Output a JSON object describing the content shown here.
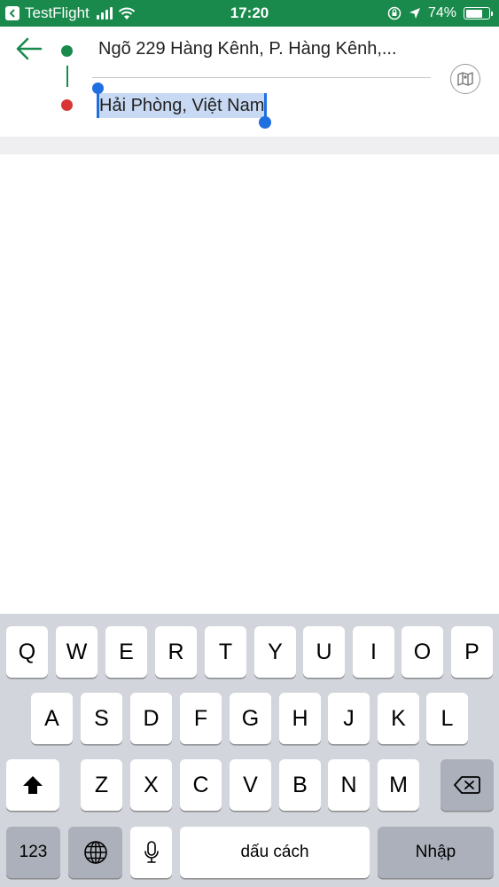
{
  "status_bar": {
    "back_app": "TestFlight",
    "time": "17:20",
    "battery": "74%",
    "battery_level": 0.74
  },
  "route": {
    "origin": "Ngõ 229 Hàng Kênh, P. Hàng Kênh,...",
    "destination": "Hải Phòng, Việt Nam",
    "origin_color": "#1a8a4c",
    "destination_color": "#d93535"
  },
  "icons": {
    "back": "arrow-left-icon",
    "map": "map-icon"
  },
  "keyboard": {
    "row1": [
      "Q",
      "W",
      "E",
      "R",
      "T",
      "Y",
      "U",
      "I",
      "O",
      "P"
    ],
    "row2": [
      "A",
      "S",
      "D",
      "F",
      "G",
      "H",
      "J",
      "K",
      "L"
    ],
    "row3": [
      "Z",
      "X",
      "C",
      "V",
      "B",
      "N",
      "M"
    ],
    "numbers_key": "123",
    "space_key": "dấu cách",
    "return_key": "Nhập"
  }
}
